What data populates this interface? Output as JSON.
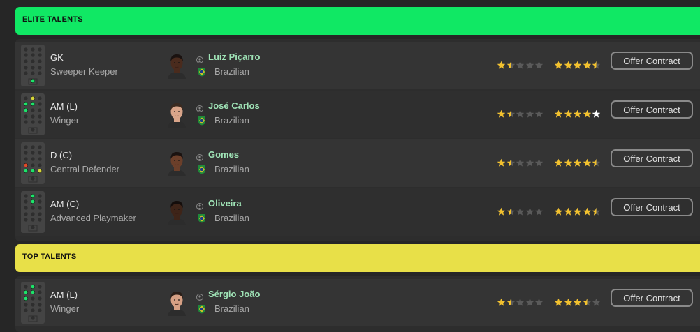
{
  "colors": {
    "elite": "#10e864",
    "top": "#e8e048",
    "star_gold": "#f2c12e",
    "star_gray": "#5a5a5a",
    "star_white": "#ffffff",
    "name_green": "#9fe3b6"
  },
  "sections": [
    {
      "title": "ELITE TALENTS",
      "players": [
        {
          "position": "GK",
          "role": "Sweeper Keeper",
          "name": "Luiz Piçarro",
          "nationality": "Brazilian",
          "current_ability_stars": 1.5,
          "potential_ability_stars": 4.5,
          "potential_last_star_white": false,
          "button": "Offer Contract",
          "face_skin": "#4a2b1d",
          "face_hair": "#1a1210",
          "pitch": [
            {
              "slot": "gk",
              "c": "#1ee36a"
            }
          ]
        },
        {
          "position": "AM (L)",
          "role": "Winger",
          "name": "José Carlos",
          "nationality": "Brazilian",
          "current_ability_stars": 1.5,
          "potential_ability_stars": 5,
          "potential_last_star_white": true,
          "button": "Offer Contract",
          "face_skin": "#d9a58a",
          "face_hair": "#3a2a20",
          "pitch": [
            {
              "slot": "aml",
              "c": "#1ee36a"
            },
            {
              "slot": "amc",
              "c": "#1ee36a"
            },
            {
              "slot": "st",
              "c": "#d6d63a"
            },
            {
              "slot": "ml",
              "c": "#1ee36a"
            }
          ]
        },
        {
          "position": "D (C)",
          "role": "Central Defender",
          "name": "Gomes",
          "nationality": "Brazilian",
          "current_ability_stars": 1.5,
          "potential_ability_stars": 4.5,
          "potential_last_star_white": false,
          "button": "Offer Contract",
          "face_skin": "#6b3f2a",
          "face_hair": "#1a1210",
          "pitch": [
            {
              "slot": "dl",
              "c": "#1ee36a"
            },
            {
              "slot": "dc",
              "c": "#1ee36a"
            },
            {
              "slot": "dr",
              "c": "#d6d63a"
            },
            {
              "slot": "dml",
              "c": "#e04a2a"
            }
          ]
        },
        {
          "position": "AM (C)",
          "role": "Advanced Playmaker",
          "name": "Oliveira",
          "nationality": "Brazilian",
          "current_ability_stars": 1.5,
          "potential_ability_stars": 4.5,
          "potential_last_star_white": false,
          "button": "Offer Contract",
          "face_skin": "#3e2418",
          "face_hair": "#140d0b",
          "pitch": [
            {
              "slot": "st",
              "c": "#1ee36a"
            },
            {
              "slot": "amc",
              "c": "#1ee36a"
            }
          ]
        }
      ]
    },
    {
      "title": "TOP TALENTS",
      "players": [
        {
          "position": "AM (L)",
          "role": "Winger",
          "name": "Sérgio João",
          "nationality": "Brazilian",
          "current_ability_stars": 1.5,
          "potential_ability_stars": 3.5,
          "potential_last_star_white": false,
          "button": "Offer Contract",
          "face_skin": "#d6a084",
          "face_hair": "#2a1e18",
          "pitch": [
            {
              "slot": "aml",
              "c": "#1ee36a"
            },
            {
              "slot": "amc",
              "c": "#1ee36a"
            },
            {
              "slot": "st",
              "c": "#1ee36a"
            },
            {
              "slot": "ml",
              "c": "#1ee36a"
            }
          ]
        }
      ]
    }
  ]
}
